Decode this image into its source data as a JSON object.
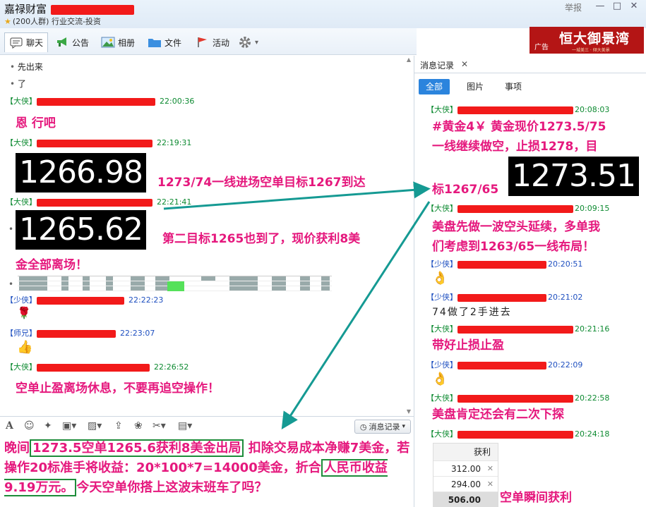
{
  "window": {
    "group_name": "嘉禄财富",
    "group_meta": "(200人群) 行业交流-投资",
    "report": "举报",
    "min": "—",
    "max": "□",
    "close": "✕"
  },
  "toolbar": {
    "chat": "聊天",
    "notice": "公告",
    "album": "相册",
    "files": "文件",
    "activity": "活动",
    "settings_arrow": "▾"
  },
  "ad": {
    "tag": "广告",
    "brand": "恒大御景湾",
    "slogan": "一城美三 · 倾大美景"
  },
  "chat": {
    "msgs_top": [
      "先出来",
      "了"
    ],
    "messages": [
      {
        "role": "【大侠】",
        "time": "22:00:36",
        "text": "恩  行吧"
      },
      {
        "role": "【大侠】",
        "time": "22:19:31",
        "price": "1266.98",
        "text": "1273/74一线进场空单目标1267到达"
      },
      {
        "role": "【大侠】",
        "time": "22:21:41",
        "price": "1265.62",
        "text": "第二目标1265也到了，现价获利8美",
        "text2": "金全部离场！"
      },
      {
        "role": "【少侠】",
        "time": "22:22:23",
        "emoji": "🌹"
      },
      {
        "role": "【师兄】",
        "time": "22:23:07",
        "emoji": "👍"
      },
      {
        "role": "【大侠】",
        "time": "22:26:52",
        "text": "空单止盈离场休息，不要再追空操作！"
      }
    ]
  },
  "inputbar": {
    "history_label": "消息记录",
    "history_arrow": "▾"
  },
  "summary": {
    "p1": "晚间",
    "b1": "1273.5空单1265.6获利8美金出局",
    "p2": "  扣除交易成本净赚7美金，若操作20标准手将收益：20*100*7=14000美金，折合",
    "b2": "人民币收益9.19万元。",
    "p3": "今天空单你搭上这波末班车了吗？"
  },
  "history": {
    "tab": "消息记录",
    "close": "✕",
    "filters": [
      "全部",
      "图片",
      "事项"
    ],
    "messages": [
      {
        "role": "【大侠】",
        "time": "20:08:03"
      },
      {
        "role": "【大侠】",
        "time": "20:09:15"
      },
      {
        "role": "【少侠】",
        "time": "20:20:51"
      },
      {
        "role": "【少侠】",
        "time": "20:21:02"
      },
      {
        "role": "【大侠】",
        "time": "20:21:16"
      },
      {
        "role": "【少侠】",
        "time": "20:22:09"
      },
      {
        "role": "【大侠】",
        "time": "20:22:58"
      },
      {
        "role": "【大侠】",
        "time": "20:24:18"
      }
    ],
    "m1_line1": "#黄金4￥ 黄金现价1273.5/75",
    "m1_line2": "一线继续做空，止损1278，目",
    "m1_line3": "标1267/65",
    "m1_price": "1273.51",
    "m2_line1": "美盘先做一波空头延续，多单我",
    "m2_line2": "们考虑到1263/65一线布局！",
    "m4_text": "74做了2手进去",
    "m5_text": "带好止损止盈",
    "m7_text": "美盘肯定还会有二次下探",
    "m8_caption": "空单瞬间获利",
    "emoji_ok": "👌"
  },
  "profit_table": {
    "header": "获利",
    "rows": [
      "312.00",
      "294.00"
    ],
    "total": "506.00",
    "x": "✕"
  },
  "colors": {
    "accent_pink": "#e5187d",
    "redact": "#f21a1a",
    "green": "#0d8a31",
    "blue_tab": "#2b84dd",
    "arrow": "#159a93"
  }
}
